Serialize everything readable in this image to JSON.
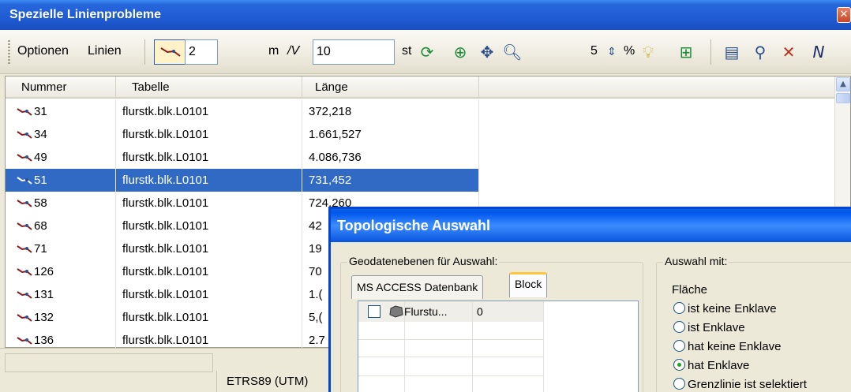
{
  "window": {
    "title": "Spezielle Linienprobleme"
  },
  "toolbar": {
    "menu_optionen": "Optionen",
    "menu_linien": "Linien",
    "min_points_value": "2",
    "unit_m": "m",
    "tolerance_value": "10",
    "unit_st": "st",
    "zoom_level_value": "5",
    "unit_percent": "%"
  },
  "table": {
    "columns": [
      "Nummer",
      "Tabelle",
      "Länge"
    ],
    "rows": [
      {
        "nummer": "31",
        "tabelle": "flurstk.blk.L0101",
        "laenge": "372,218"
      },
      {
        "nummer": "34",
        "tabelle": "flurstk.blk.L0101",
        "laenge": "1.661,527"
      },
      {
        "nummer": "49",
        "tabelle": "flurstk.blk.L0101",
        "laenge": "4.086,736"
      },
      {
        "nummer": "51",
        "tabelle": "flurstk.blk.L0101",
        "laenge": "731,452"
      },
      {
        "nummer": "58",
        "tabelle": "flurstk.blk.L0101",
        "laenge": "724,260"
      },
      {
        "nummer": "68",
        "tabelle": "flurstk.blk.L0101",
        "laenge": "42"
      },
      {
        "nummer": "71",
        "tabelle": "flurstk.blk.L0101",
        "laenge": "19"
      },
      {
        "nummer": "126",
        "tabelle": "flurstk.blk.L0101",
        "laenge": "70"
      },
      {
        "nummer": "131",
        "tabelle": "flurstk.blk.L0101",
        "laenge": "1.("
      },
      {
        "nummer": "132",
        "tabelle": "flurstk.blk.L0101",
        "laenge": "5,("
      },
      {
        "nummer": "136",
        "tabelle": "flurstk.blk.L0101",
        "laenge": "2.7"
      }
    ],
    "selected_row": "51"
  },
  "status": {
    "crs": "ETRS89 (UTM)"
  },
  "dialog": {
    "title": "Topologische Auswahl",
    "layers_group": "Geodatenebenen für Auswahl:",
    "tabs": [
      "MS ACCESS Datenbank",
      "Block"
    ],
    "active_tab": "Block",
    "layer_row": {
      "name": "Flurstu...",
      "count": "0"
    },
    "selection_group": "Auswahl mit:",
    "flaeche_label": "Fläche",
    "radio_options": [
      "ist keine Enklave",
      "ist Enklave",
      "hat keine Enklave",
      "hat Enklave",
      "Grenzlinie ist selektiert"
    ],
    "radio_selected": "hat Enklave"
  },
  "colors": {
    "xp_title_blue": "#1F5BD3",
    "selection_blue": "#316AC5",
    "line_icon": "#8B1A1A"
  }
}
